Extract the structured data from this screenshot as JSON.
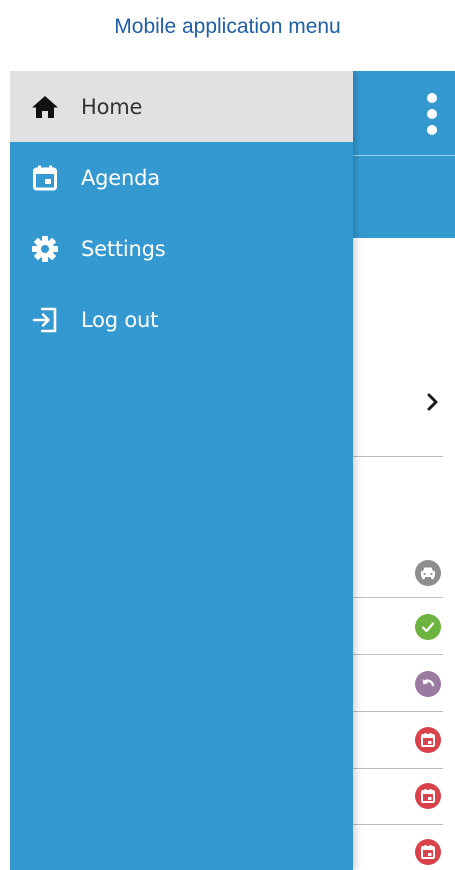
{
  "caption": "Mobile application menu",
  "drawer": {
    "items": [
      {
        "label": "Home",
        "icon": "home-icon",
        "active": true
      },
      {
        "label": "Agenda",
        "icon": "calendar-icon",
        "active": false
      },
      {
        "label": "Settings",
        "icon": "gear-icon",
        "active": false
      },
      {
        "label": "Log out",
        "icon": "logout-icon",
        "active": false
      }
    ]
  },
  "app": {
    "header_icon": "more-vertical-icon",
    "row_chevron_icon": "chevron-right-icon",
    "status_icons": [
      {
        "icon": "car-icon",
        "color": "#8e8e8e"
      },
      {
        "icon": "check-icon",
        "color": "#6db33f"
      },
      {
        "icon": "undo-icon",
        "color": "#9a7aa0"
      },
      {
        "icon": "calendar-icon",
        "color": "#d9424a"
      },
      {
        "icon": "calendar-icon",
        "color": "#d9424a"
      },
      {
        "icon": "calendar-icon",
        "color": "#d9424a"
      }
    ]
  },
  "colors": {
    "primary": "#3499d1",
    "active_item_bg": "#e1e1e1",
    "caption": "#1f5fa8"
  }
}
